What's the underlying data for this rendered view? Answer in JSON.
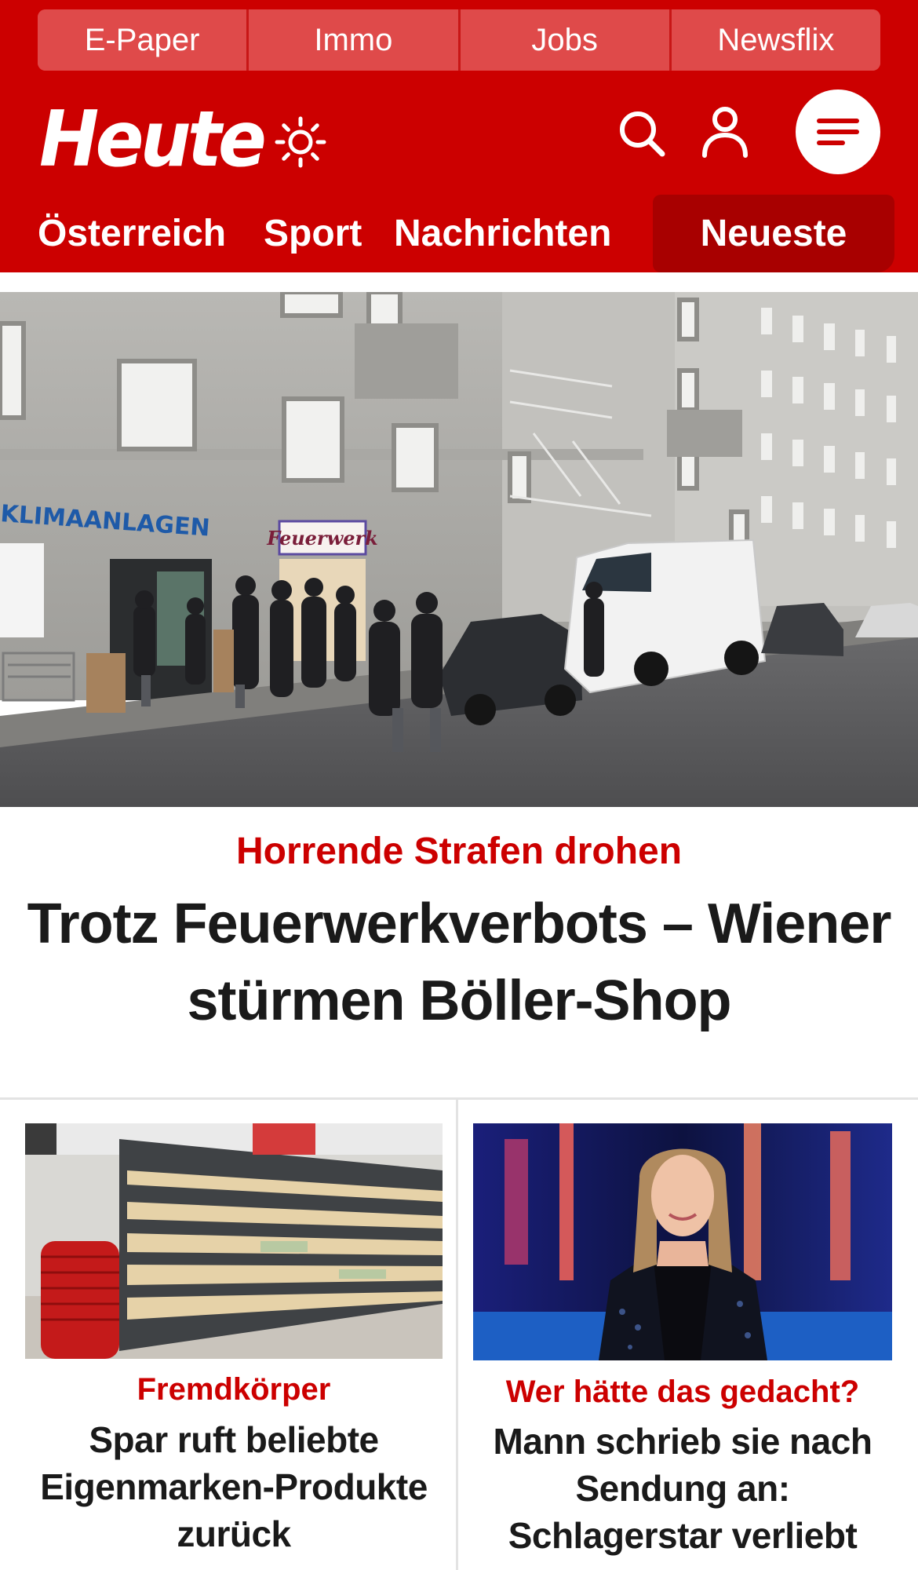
{
  "colors": {
    "brand_red": "#cc0000",
    "active_tab": "#a80000",
    "top_nav_bg": "#df4a4a",
    "headline": "#1a1a1a",
    "kicker": "#cc0000",
    "divider": "#e3e3e3"
  },
  "top_nav": {
    "items": [
      {
        "label": "E-Paper"
      },
      {
        "label": "Immo"
      },
      {
        "label": "Jobs"
      },
      {
        "label": "Newsflix"
      }
    ]
  },
  "header": {
    "logo_text": "Heute",
    "icons": [
      "sun-icon",
      "search-icon",
      "user-icon",
      "menu-icon"
    ]
  },
  "section_nav": {
    "items": [
      {
        "label": "Österreich"
      },
      {
        "label": "Sport"
      },
      {
        "label": "Nachrichten"
      }
    ],
    "active_label": "Neueste"
  },
  "hero": {
    "kicker": "Horrende Strafen drohen",
    "headline": "Trotz Feuerwerkverbots – Wiener stürmen Böller-Shop",
    "image_signs": {
      "store_sign": "KLIMAANLAGEN",
      "shop_sign": "Feuerwerk"
    }
  },
  "teasers": [
    {
      "kicker": "Fremdkörper",
      "headline": "Spar ruft beliebte Eigenmarken-Produkte zurück"
    },
    {
      "kicker": "Wer hätte das gedacht?",
      "headline": "Mann schrieb sie nach Sendung an: Schlagerstar verliebt"
    }
  ]
}
